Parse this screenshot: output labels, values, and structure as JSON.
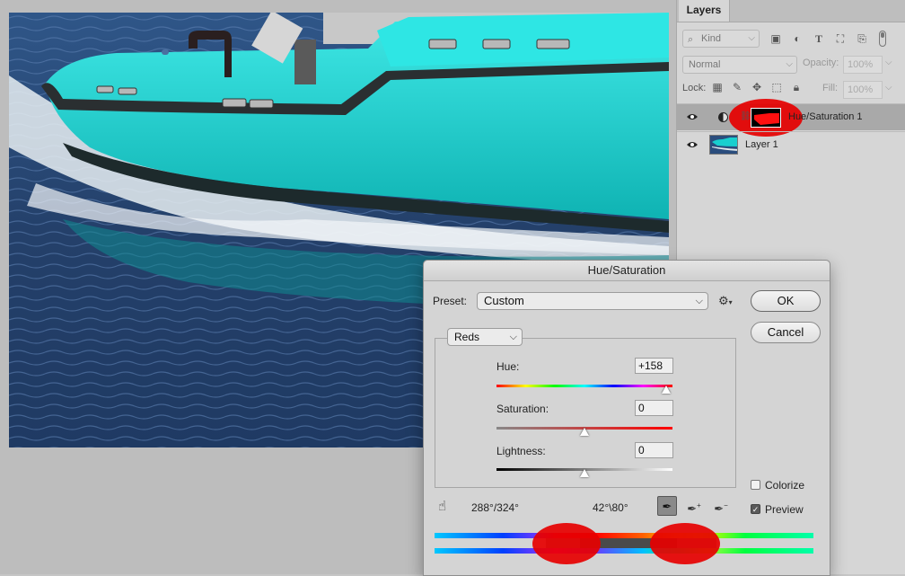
{
  "layers_panel": {
    "tab": "Layers",
    "filter_kind": "Kind",
    "blend_mode": "Normal",
    "opacity_label": "Opacity:",
    "opacity_value": "100%",
    "lock_label": "Lock:",
    "fill_label": "Fill:",
    "fill_value": "100%",
    "layers": [
      {
        "name": "Hue/Saturation 1",
        "selected": true,
        "type": "adjustment"
      },
      {
        "name": "Layer 1",
        "selected": false,
        "type": "image"
      }
    ]
  },
  "dialog": {
    "title": "Hue/Saturation",
    "preset_label": "Preset:",
    "preset_value": "Custom",
    "ok_label": "OK",
    "cancel_label": "Cancel",
    "channel": "Reds",
    "hue_label": "Hue:",
    "hue_value": "+158",
    "saturation_label": "Saturation:",
    "saturation_value": "0",
    "lightness_label": "Lightness:",
    "lightness_value": "0",
    "colorize_label": "Colorize",
    "colorize_checked": false,
    "preview_label": "Preview",
    "preview_checked": true,
    "range_left": "288°/324°",
    "range_right": "42°\\80°"
  },
  "colors": {
    "annotation_red": "#e60000",
    "boat_cyan": "#12d4d0",
    "water_blue": "#2b4d7a"
  }
}
